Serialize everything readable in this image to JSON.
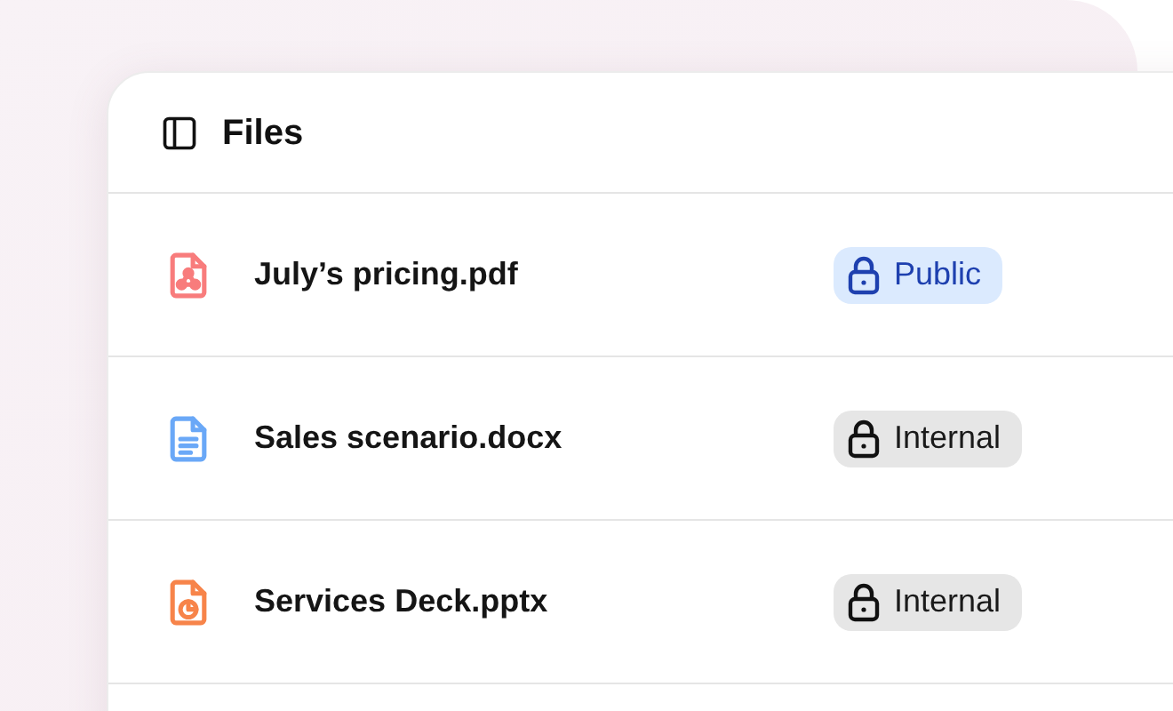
{
  "panel": {
    "title": "Files"
  },
  "files": [
    {
      "name": "July’s pricing.pdf",
      "kind": "pdf",
      "access": {
        "label": "Public",
        "kind": "public"
      }
    },
    {
      "name": "Sales scenario.docx",
      "kind": "doc",
      "access": {
        "label": "Internal",
        "kind": "internal"
      }
    },
    {
      "name": "Services Deck.pptx",
      "kind": "ppt",
      "access": {
        "label": "Internal",
        "kind": "internal"
      }
    }
  ]
}
